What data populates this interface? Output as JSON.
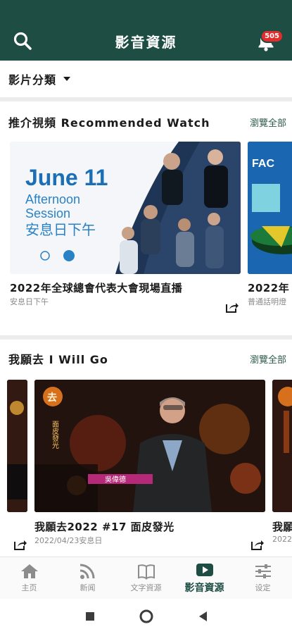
{
  "app": {
    "title": "影音資源",
    "notification_count": "505"
  },
  "category": {
    "label": "影片分類"
  },
  "recommended": {
    "title": "推介視頻 Recommended Watch",
    "view_all": "瀏覽全部",
    "videos": [
      {
        "title": "2022年全球總會代表大會現場直播",
        "subtitle": "安息日下午",
        "thumb": {
          "headline": "June 11",
          "line1": "Afternoon",
          "line2": "Session",
          "line3": "安息日下午"
        }
      },
      {
        "title": "2022年",
        "subtitle": "普通話明燈",
        "thumb": {
          "tag": "FAC"
        }
      }
    ]
  },
  "iwillgo": {
    "title": "我願去 I Will Go",
    "view_all": "瀏覽全部",
    "videos": [
      {
        "title": "我願去2022 #17 面皮發光",
        "subtitle": "2022/04/23安息日",
        "thumb": {
          "logo": "去",
          "vertical_text": "面皮發光",
          "name_banner": "吳偉德"
        }
      },
      {
        "title": "我願",
        "subtitle": "2022"
      }
    ]
  },
  "tabs": [
    {
      "label": "主页",
      "icon": "home-icon"
    },
    {
      "label": "新闻",
      "icon": "rss-icon"
    },
    {
      "label": "文字資源",
      "icon": "book-icon"
    },
    {
      "label": "影音資源",
      "icon": "play-icon",
      "active": true
    },
    {
      "label": "设定",
      "icon": "sliders-icon"
    }
  ],
  "colors": {
    "brand": "#1d4d43",
    "badge": "#e32c2c",
    "link": "#2e5a4e"
  }
}
